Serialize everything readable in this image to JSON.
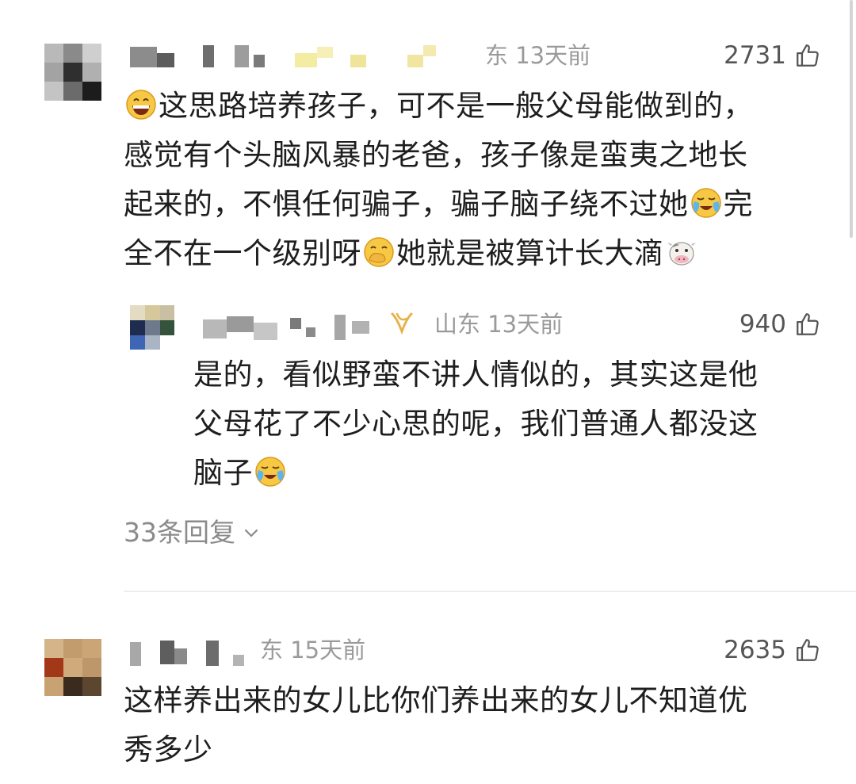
{
  "comments": [
    {
      "location_time": "东 13天前",
      "likes": "2731",
      "lines": [
        "这思路培养孩子，可不是一般父母能做到的，",
        "感觉有个头脑风暴的老爸，孩子像是蛮夷之地长",
        "起来的，不惧任何骗子，骗子脑子绕不过她",
        "全不在一个级别呀"
      ],
      "line3_tail": "完",
      "line4_tail": "她就是被算计长大滴",
      "emoji_names": [
        "grinning-emoji",
        "crying-emoji",
        "hand-over-mouth-emoji",
        "cow-emoji"
      ]
    },
    {
      "location_time": "山东 13天前",
      "likes": "940",
      "lines": [
        "是的，看似野蛮不讲人情似的，其实这是他",
        "父母花了不少心思的呢，我们普通人都没这",
        "脑子"
      ],
      "emoji_names": [
        "crying-emoji"
      ]
    },
    {
      "location_time": "东 15天前",
      "likes": "2635",
      "lines": [
        "这样养出来的女儿比你们养出来的女儿不知道优",
        "秀多少"
      ]
    }
  ],
  "replies_label": "33条回复",
  "colors": {
    "meta_gray": "#9a9a9a",
    "text": "#1e1e1e",
    "vip_gold": "#e8b14a"
  },
  "icons": {
    "like": "thumbs-up-icon",
    "expand": "chevron-down-icon",
    "vip": "vip-badge-icon"
  }
}
